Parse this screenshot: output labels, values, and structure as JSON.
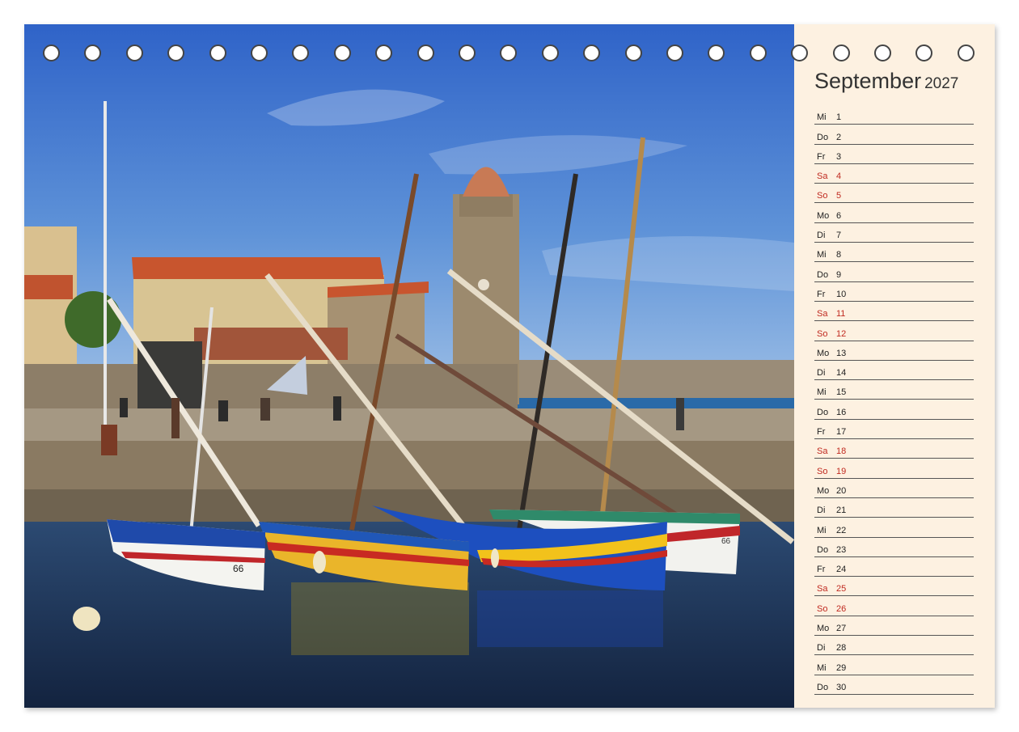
{
  "calendar": {
    "month": "September",
    "year": "2027",
    "days": [
      {
        "weekday": "Mi",
        "day": "1",
        "weekend": false
      },
      {
        "weekday": "Do",
        "day": "2",
        "weekend": false
      },
      {
        "weekday": "Fr",
        "day": "3",
        "weekend": false
      },
      {
        "weekday": "Sa",
        "day": "4",
        "weekend": true
      },
      {
        "weekday": "So",
        "day": "5",
        "weekend": true
      },
      {
        "weekday": "Mo",
        "day": "6",
        "weekend": false
      },
      {
        "weekday": "Di",
        "day": "7",
        "weekend": false
      },
      {
        "weekday": "Mi",
        "day": "8",
        "weekend": false
      },
      {
        "weekday": "Do",
        "day": "9",
        "weekend": false
      },
      {
        "weekday": "Fr",
        "day": "10",
        "weekend": false
      },
      {
        "weekday": "Sa",
        "day": "11",
        "weekend": true
      },
      {
        "weekday": "So",
        "day": "12",
        "weekend": true
      },
      {
        "weekday": "Mo",
        "day": "13",
        "weekend": false
      },
      {
        "weekday": "Di",
        "day": "14",
        "weekend": false
      },
      {
        "weekday": "Mi",
        "day": "15",
        "weekend": false
      },
      {
        "weekday": "Do",
        "day": "16",
        "weekend": false
      },
      {
        "weekday": "Fr",
        "day": "17",
        "weekend": false
      },
      {
        "weekday": "Sa",
        "day": "18",
        "weekend": true
      },
      {
        "weekday": "So",
        "day": "19",
        "weekend": true
      },
      {
        "weekday": "Mo",
        "day": "20",
        "weekend": false
      },
      {
        "weekday": "Di",
        "day": "21",
        "weekend": false
      },
      {
        "weekday": "Mi",
        "day": "22",
        "weekend": false
      },
      {
        "weekday": "Do",
        "day": "23",
        "weekend": false
      },
      {
        "weekday": "Fr",
        "day": "24",
        "weekend": false
      },
      {
        "weekday": "Sa",
        "day": "25",
        "weekend": true
      },
      {
        "weekday": "So",
        "day": "26",
        "weekend": true
      },
      {
        "weekday": "Mo",
        "day": "27",
        "weekend": false
      },
      {
        "weekday": "Di",
        "day": "28",
        "weekend": false
      },
      {
        "weekday": "Mi",
        "day": "29",
        "weekend": false
      },
      {
        "weekday": "Do",
        "day": "30",
        "weekend": false
      }
    ]
  },
  "photo": {
    "boat_label_1": "66",
    "boat_label_2": "66"
  },
  "colors": {
    "weekend": "#c02a20",
    "panel_bg": "#fdf1e1"
  }
}
